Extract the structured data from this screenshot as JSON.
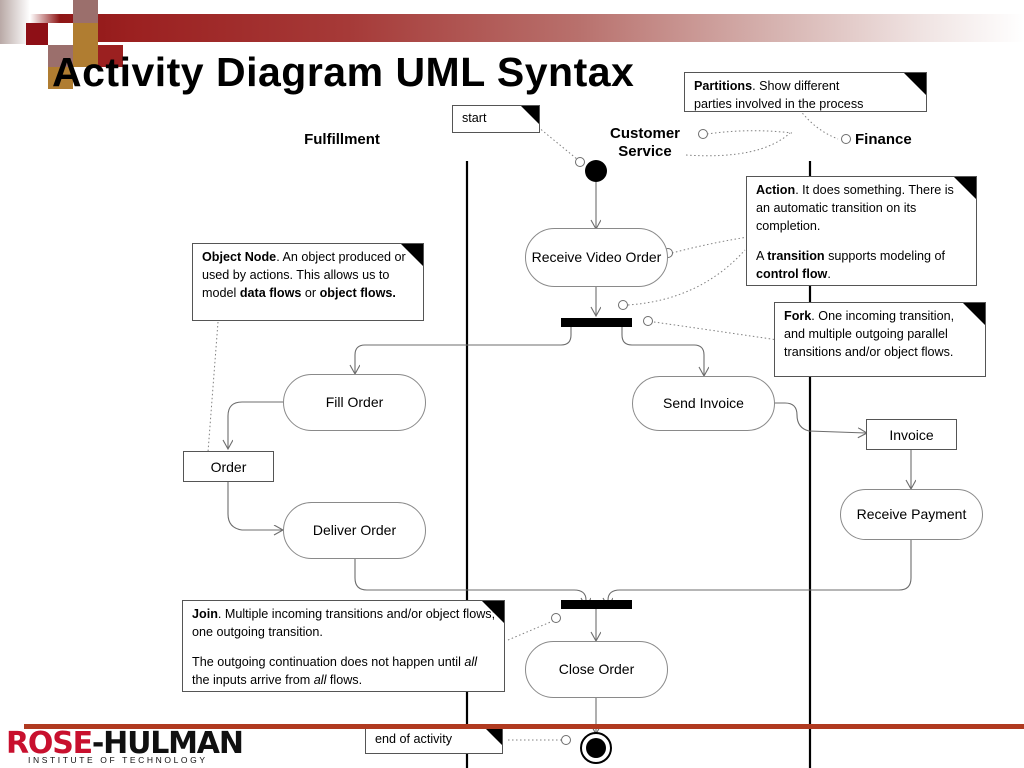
{
  "slide": {
    "title": "Activity Diagram UML Syntax",
    "accent_color": "#9b2020",
    "footer_rule_color": "#b03a20"
  },
  "partitions": [
    {
      "label": "Fulfillment"
    },
    {
      "label": "Customer Service"
    },
    {
      "label": "Finance"
    }
  ],
  "notes": {
    "start": {
      "text": "start"
    },
    "partitions": {
      "line1_bold": "Partitions",
      "line1_rest": ". Show different",
      "line2": "parties involved in the process"
    },
    "action": {
      "p1_bold": "Action",
      "p1_rest": ". It does something. There is an automatic transition on its completion.",
      "p2_pre": " A ",
      "p2_bold1": "transition",
      "p2_mid": " supports modeling of ",
      "p2_bold2": "control flow",
      "p2_end": "."
    },
    "fork": {
      "bold": "Fork",
      "rest": ". One incoming transition, and multiple outgoing parallel transitions and/or object flows."
    },
    "object_node": {
      "bold": "Object Node",
      "rest1": ". An object produced or used by actions. This allows us to model ",
      "bold2": "data flows",
      "rest2": " or ",
      "bold3": "object flows."
    },
    "join": {
      "p1_bold": "Join",
      "p1_rest": ". Multiple incoming transitions and/or object flows; one outgoing transition.",
      "p2_pre": "The outgoing continuation does not happen until ",
      "p2_i1": "all",
      "p2_mid": " the inputs arrive from ",
      "p2_i2": "all",
      "p2_end": " flows."
    },
    "end": {
      "text": "end of activity"
    }
  },
  "nodes": {
    "receive_video_order": "Receive Video Order",
    "fill_order": "Fill Order",
    "order": "Order",
    "deliver_order": "Deliver Order",
    "send_invoice": "Send Invoice",
    "invoice": "Invoice",
    "receive_payment": "Receive Payment",
    "close_order": "Close Order"
  },
  "logo": {
    "rose": "ROSE",
    "dash": "-",
    "hulman": "HULMAN",
    "subtitle": "INSTITUTE OF TECHNOLOGY"
  }
}
